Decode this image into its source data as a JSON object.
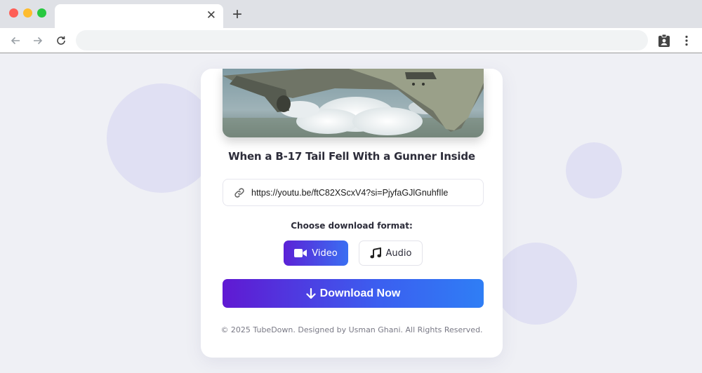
{
  "browser": {
    "tab_close": "✕",
    "new_tab": "+"
  },
  "card": {
    "video_title": "When a B-17 Tail Fell With a Gunner Inside",
    "url_value": "https://youtu.be/ftC82XScxV4?si=PjyfaGJlGnuhfIle",
    "format_label": "Choose download format:",
    "formats": [
      {
        "label": "Video",
        "icon": "video-camera-icon",
        "selected": true
      },
      {
        "label": "Audio",
        "icon": "music-note-icon",
        "selected": false
      }
    ],
    "download_label": "Download Now",
    "footer": "© 2025 TubeDown. Designed by Usman Ghani. All Rights Reserved."
  },
  "colors": {
    "accent_start": "#5b21d6",
    "accent_end": "#2f7ef5",
    "page_bg": "#eff0f5"
  }
}
